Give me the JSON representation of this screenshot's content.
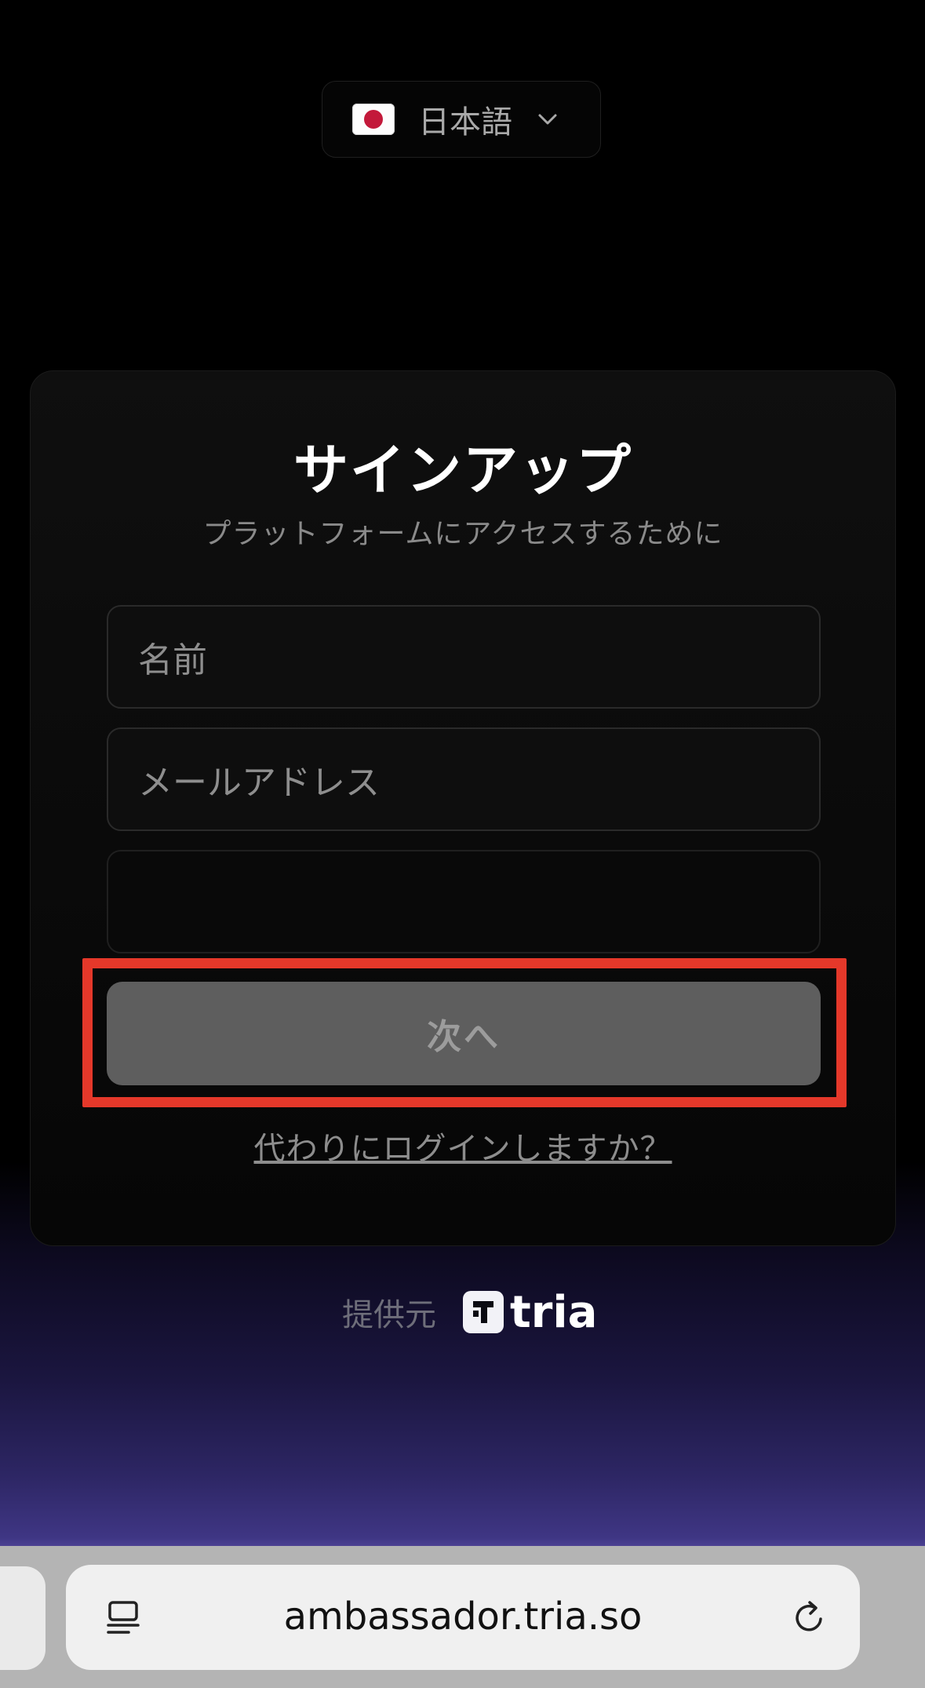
{
  "language_selector": {
    "label": "日本語",
    "flag": "japan-flag-icon"
  },
  "card": {
    "title": "サインアップ",
    "subtitle": "プラットフォームにアクセスするために",
    "name_placeholder": "名前",
    "email_placeholder": "メールアドレス",
    "next_label": "次へ",
    "login_link": "代わりにログインしますか？"
  },
  "footer": {
    "powered_by": "提供元",
    "brand": "tria"
  },
  "browser": {
    "url": "ambassador.tria.so"
  },
  "colors": {
    "highlight": "#e5382a",
    "button_disabled": "#5e5e5e"
  }
}
